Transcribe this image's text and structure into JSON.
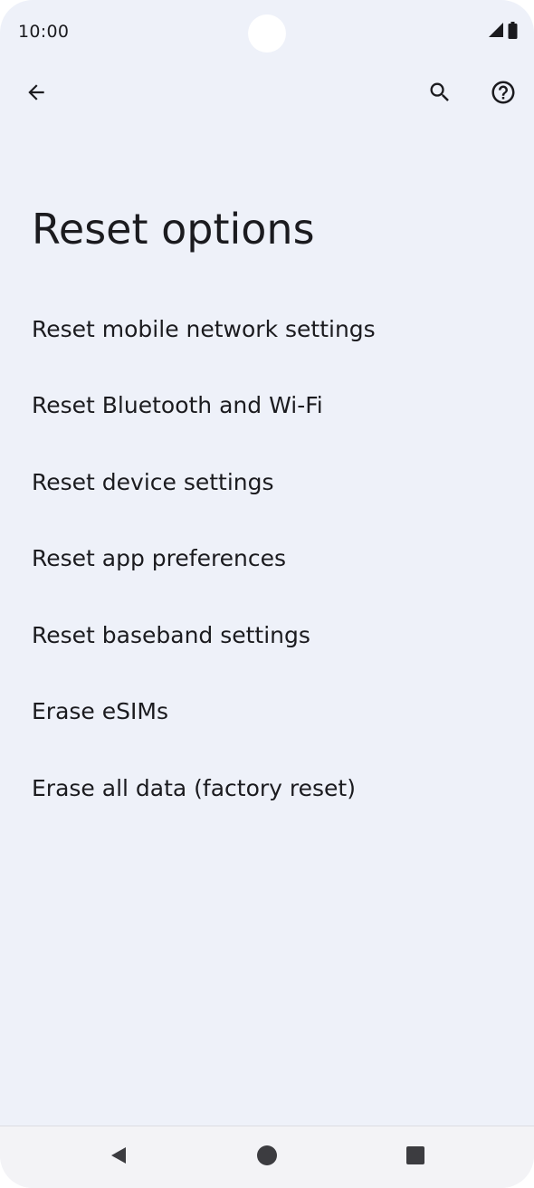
{
  "status_bar": {
    "time": "10:00",
    "icons": [
      "signal-icon",
      "battery-icon"
    ]
  },
  "app_bar": {
    "back_icon": "arrow-back-icon",
    "search_icon": "search-icon",
    "help_icon": "help-icon"
  },
  "page": {
    "title": "Reset options"
  },
  "options": [
    {
      "label": "Reset mobile network settings"
    },
    {
      "label": "Reset Bluetooth and Wi-Fi"
    },
    {
      "label": "Reset device settings"
    },
    {
      "label": "Reset app preferences"
    },
    {
      "label": "Reset baseband settings"
    },
    {
      "label": "Erase eSIMs"
    },
    {
      "label": "Erase all data (factory reset)"
    }
  ],
  "nav_bar": {
    "icons": [
      "nav-back-icon",
      "nav-home-icon",
      "nav-recents-icon"
    ]
  },
  "colors": {
    "background": "#eef1f9",
    "text": "#1b1b1f",
    "nav_bar": "#f3f3f6"
  }
}
